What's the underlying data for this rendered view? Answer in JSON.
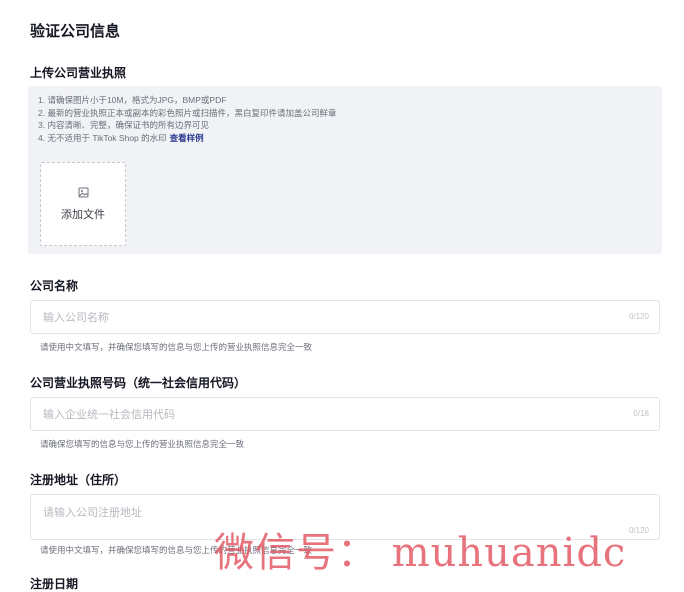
{
  "page_title": "验证公司信息",
  "license_upload": {
    "label": "上传公司营业执照",
    "rules": [
      "1. 请确保图片小于10M，格式为JPG，BMP或PDF",
      "2. 最新的营业执照正本或副本的彩色照片或扫描件，黑白复印件请加盖公司鲜章",
      "3. 内容清晰、完整，确保证书的所有边界可见",
      "4. 无不适用于 TikTok Shop 的水印"
    ],
    "example_link": "查看样例",
    "add_file_label": "添加文件",
    "icon": "image-icon"
  },
  "company_name": {
    "label": "公司名称",
    "placeholder": "输入公司名称",
    "value": "",
    "counter": "0/120",
    "hint": "请使用中文填写，并确保您填写的信息与您上传的营业执照信息完全一致"
  },
  "license_number": {
    "label": "公司营业执照号码（统一社会信用代码）",
    "placeholder": "输入企业统一社会信用代码",
    "value": "",
    "counter": "0/18",
    "hint": "请确保您填写的信息与您上传的营业执照信息完全一致"
  },
  "registered_address": {
    "label": "注册地址（住所）",
    "placeholder": "请输入公司注册地址",
    "value": "",
    "counter": "0/120",
    "hint": "请使用中文填写，并确保您填写的信息与您上传的营业执照信息完全一致"
  },
  "registration_date": {
    "label": "注册日期"
  },
  "watermark_text": "微信号： muhuanidc"
}
